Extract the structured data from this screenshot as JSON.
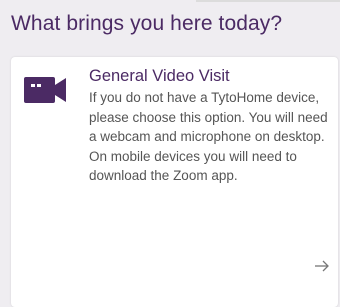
{
  "page": {
    "heading": "What brings you here today?"
  },
  "options": [
    {
      "icon": "video-camera-icon",
      "title": "General Video Visit",
      "description": "If you do not have a TytoHome device, please choose this option. You will need a webcam and microphone on desktop. On mobile devices you will need to download the Zoom app.",
      "action_icon": "arrow-right-icon"
    }
  ],
  "colors": {
    "brand": "#4b2a64",
    "background": "#efedf1",
    "card": "#ffffff",
    "body_text": "#555555"
  }
}
